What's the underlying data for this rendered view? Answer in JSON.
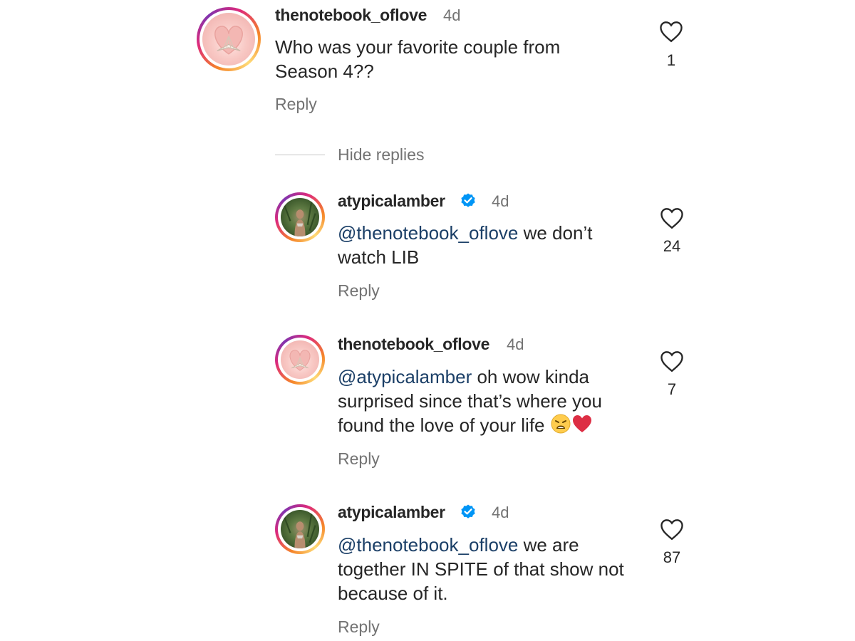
{
  "thread": {
    "top_comment": {
      "username": "thenotebook_oflove",
      "time": "4d",
      "text": "Who was your favorite couple from Season 4??",
      "reply_label": "Reply",
      "likes": "1",
      "avatar_icon": "book-heart-avatar-icon"
    },
    "hide_replies_label": "Hide replies",
    "replies": [
      {
        "username": "atypicalamber",
        "verified": true,
        "time": "4d",
        "mention": "@thenotebook_oflove",
        "text": " we don’t watch LIB",
        "reply_label": "Reply",
        "likes": "24"
      },
      {
        "username": "thenotebook_oflove",
        "verified": false,
        "time": "4d",
        "mention": "@atypicalamber",
        "text": " oh wow kinda surprised since that’s where you found the love of your life ",
        "emojis": [
          "weary-face-emoji",
          "red-heart-emoji"
        ],
        "reply_label": "Reply",
        "likes": "7"
      },
      {
        "username": "atypicalamber",
        "verified": true,
        "time": "4d",
        "mention": "@thenotebook_oflove",
        "text": " we are together IN SPITE of that show not because of it.",
        "reply_label": "Reply",
        "likes": "87"
      }
    ]
  },
  "colors": {
    "text": "#262626",
    "secondary": "#737373",
    "mention": "#1b3f67",
    "verified": "#0095f6"
  }
}
